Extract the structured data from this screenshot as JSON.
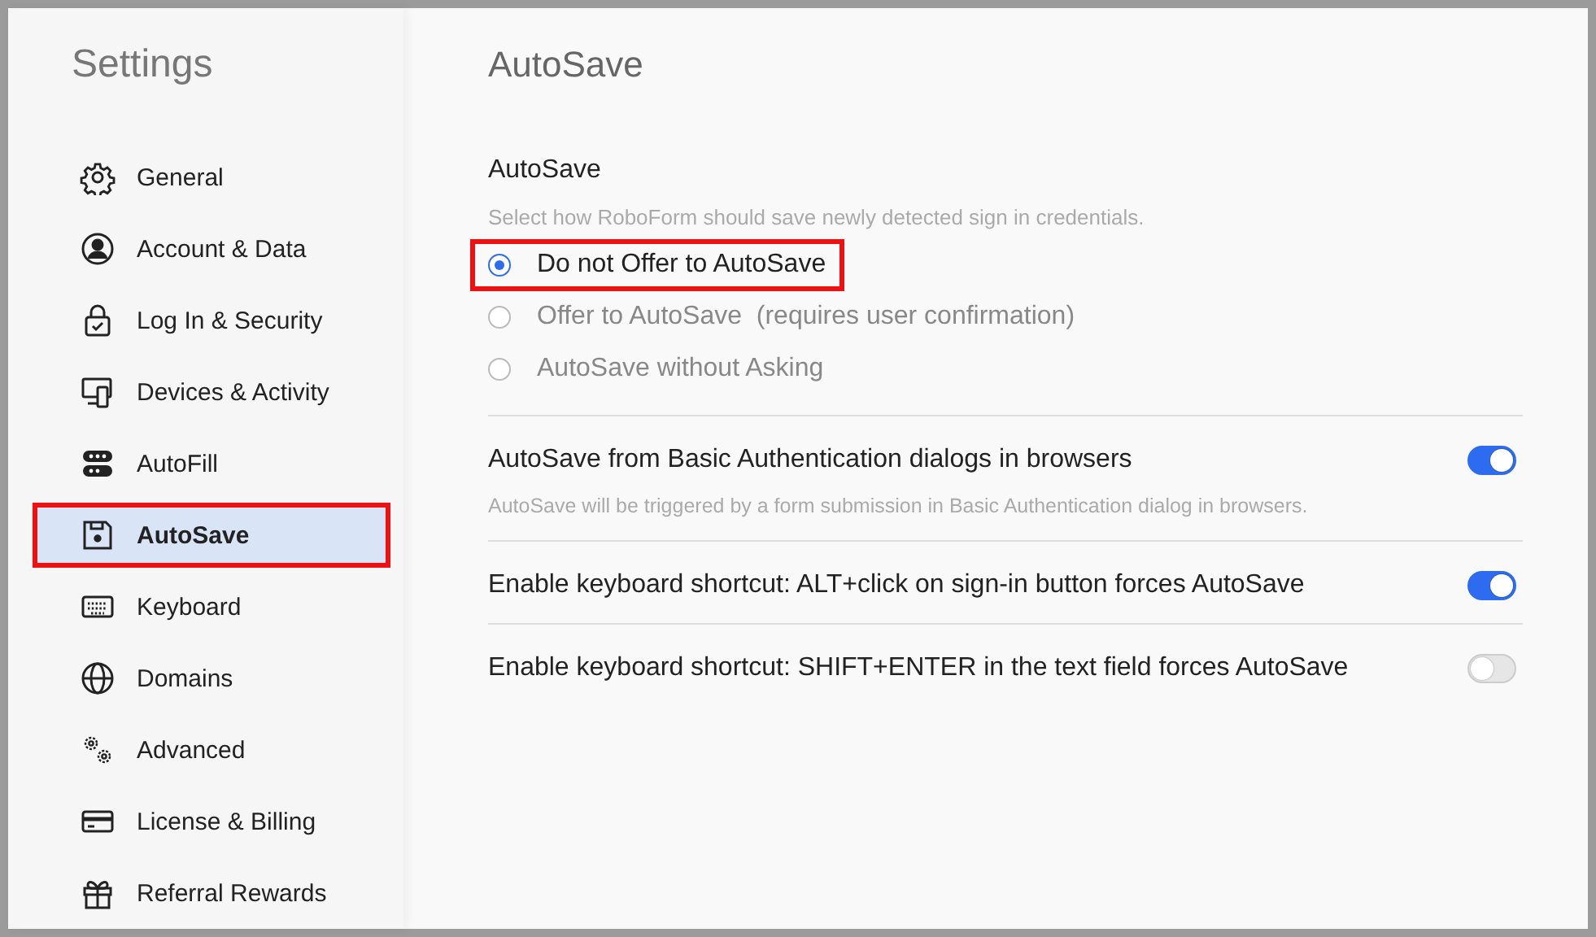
{
  "sidebar": {
    "title": "Settings",
    "items": [
      {
        "label": "General",
        "selected": false,
        "highlighted": false
      },
      {
        "label": "Account & Data",
        "selected": false,
        "highlighted": false
      },
      {
        "label": "Log In & Security",
        "selected": false,
        "highlighted": false
      },
      {
        "label": "Devices & Activity",
        "selected": false,
        "highlighted": false
      },
      {
        "label": "AutoFill",
        "selected": false,
        "highlighted": false
      },
      {
        "label": "AutoSave",
        "selected": true,
        "highlighted": true
      },
      {
        "label": "Keyboard",
        "selected": false,
        "highlighted": false
      },
      {
        "label": "Domains",
        "selected": false,
        "highlighted": false
      },
      {
        "label": "Advanced",
        "selected": false,
        "highlighted": false
      },
      {
        "label": "License & Billing",
        "selected": false,
        "highlighted": false
      },
      {
        "label": "Referral Rewards",
        "selected": false,
        "highlighted": false
      }
    ]
  },
  "page_title": "AutoSave",
  "autosave_section": {
    "heading": "AutoSave",
    "description": "Select how RoboForm should save newly detected sign in credentials.",
    "options": [
      {
        "label": "Do not Offer to AutoSave",
        "selected": true,
        "highlighted": true
      },
      {
        "label": "Offer to AutoSave  (requires user confirmation)",
        "selected": false,
        "highlighted": false
      },
      {
        "label": "AutoSave without Asking",
        "selected": false,
        "highlighted": false
      }
    ]
  },
  "toggles": [
    {
      "label": "AutoSave from Basic Authentication dialogs in browsers",
      "description": "AutoSave will be triggered by a form submission in Basic Authentication dialog in browsers.",
      "on": true
    },
    {
      "label": "Enable keyboard shortcut: ALT+click on sign-in button forces AutoSave",
      "on": true
    },
    {
      "label": "Enable keyboard shortcut: SHIFT+ENTER in the text field forces AutoSave",
      "on": false
    }
  ]
}
